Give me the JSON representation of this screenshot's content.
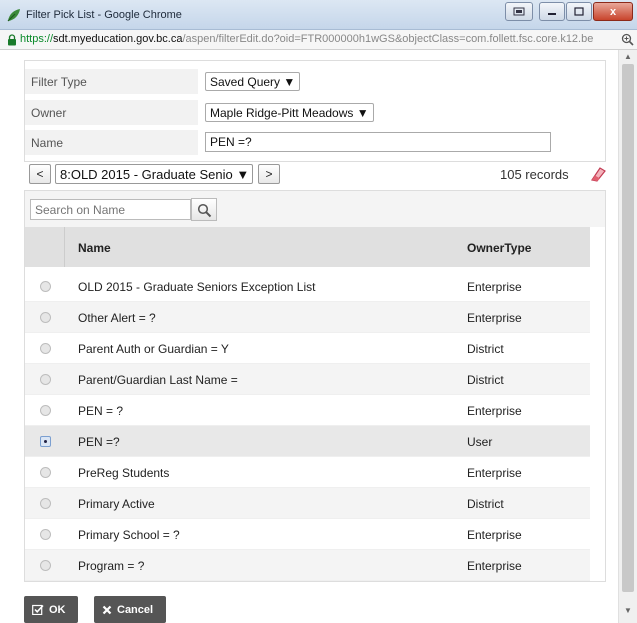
{
  "window": {
    "title": "Filter Pick List - Google Chrome",
    "url_scheme": "https://",
    "url_host": "sdt.myeducation.gov.bc.ca",
    "url_path": "/aspen/filterEdit.do?oid=FTR000000h1wGS&objectClass=com.follett.fsc.core.k12.be",
    "close_label": "x"
  },
  "form": {
    "filter_type_label": "Filter Type",
    "filter_type_value": "Saved Query ▼",
    "owner_label": "Owner",
    "owner_value": "Maple Ridge-Pitt Meadows ▼",
    "name_label": "Name",
    "name_value": "PEN =?"
  },
  "navigator": {
    "prev_label": "<",
    "next_label": ">",
    "selected": "8:OLD 2015 - Graduate Senio ▼",
    "records": "105 records"
  },
  "grid": {
    "search_placeholder": "Search on Name",
    "columns": {
      "name": "Name",
      "owner_type": "OwnerType"
    },
    "rows": [
      {
        "name": "OLD 2015 - Graduate Seniors Exception List",
        "owner_type": "Enterprise",
        "selected": false
      },
      {
        "name": "Other Alert = ?",
        "owner_type": "Enterprise",
        "selected": false
      },
      {
        "name": "Parent Auth or Guardian = Y",
        "owner_type": "District",
        "selected": false
      },
      {
        "name": "Parent/Guardian Last Name =",
        "owner_type": "District",
        "selected": false
      },
      {
        "name": "PEN = ?",
        "owner_type": "Enterprise",
        "selected": false
      },
      {
        "name": "PEN =?",
        "owner_type": "User",
        "selected": true
      },
      {
        "name": "PreReg Students",
        "owner_type": "Enterprise",
        "selected": false
      },
      {
        "name": "Primary Active",
        "owner_type": "District",
        "selected": false
      },
      {
        "name": "Primary School = ?",
        "owner_type": "Enterprise",
        "selected": false
      },
      {
        "name": "Program = ?",
        "owner_type": "Enterprise",
        "selected": false
      }
    ]
  },
  "footer": {
    "ok_label": "OK",
    "cancel_label": "Cancel"
  },
  "colors": {
    "accent": "#3a6fb0",
    "button_dark": "#555555",
    "eraser": "#e06070"
  }
}
